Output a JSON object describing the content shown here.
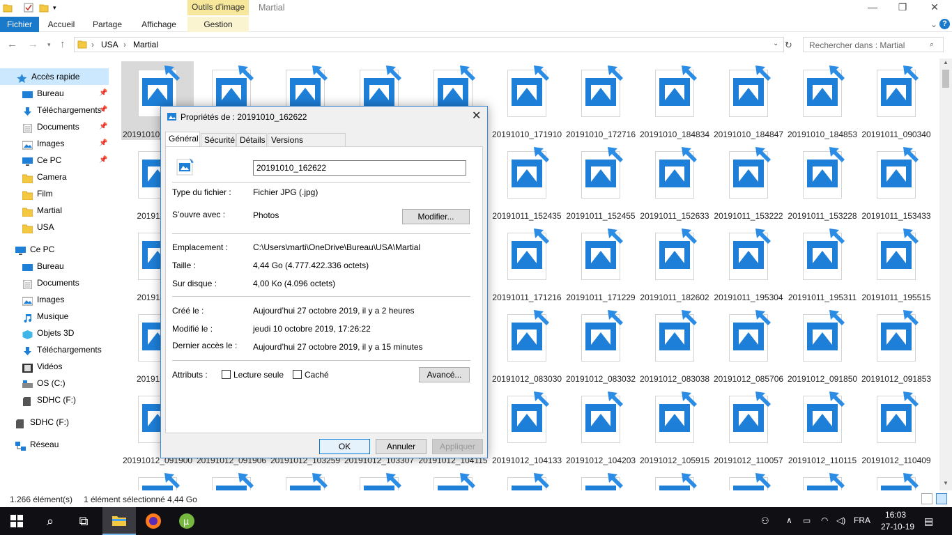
{
  "window": {
    "title": "Martial",
    "context_tab": "Outils d’image",
    "controls": {
      "minimize": "—",
      "restore": "❐",
      "close": "✕"
    }
  },
  "ribbon": {
    "tabs": [
      "Fichier",
      "Accueil",
      "Partage",
      "Affichage",
      "Gestion"
    ],
    "help": "?"
  },
  "address": {
    "crumbs": [
      "USA",
      "Martial"
    ],
    "search_placeholder": "Rechercher dans : Martial"
  },
  "nav": {
    "items": [
      {
        "label": "Accès rapide",
        "icon": "star-icon"
      },
      {
        "label": "Bureau",
        "icon": "desktop-icon",
        "pinned": true
      },
      {
        "label": "Téléchargements",
        "icon": "download-icon",
        "pinned": true
      },
      {
        "label": "Documents",
        "icon": "documents-icon",
        "pinned": true
      },
      {
        "label": "Images",
        "icon": "images-icon",
        "pinned": true
      },
      {
        "label": "Ce PC",
        "icon": "pc-icon",
        "pinned": true
      },
      {
        "label": "Camera",
        "icon": "folder-icon"
      },
      {
        "label": "Film",
        "icon": "folder-icon"
      },
      {
        "label": "Martial",
        "icon": "folder-icon"
      },
      {
        "label": "USA",
        "icon": "folder-icon"
      },
      {
        "label": "Ce PC",
        "icon": "pc-icon"
      },
      {
        "label": "Bureau",
        "icon": "desktop-icon"
      },
      {
        "label": "Documents",
        "icon": "documents-icon"
      },
      {
        "label": "Images",
        "icon": "images-icon"
      },
      {
        "label": "Musique",
        "icon": "music-icon"
      },
      {
        "label": "Objets 3D",
        "icon": "cube-icon"
      },
      {
        "label": "Téléchargements",
        "icon": "download-icon"
      },
      {
        "label": "Vidéos",
        "icon": "video-icon"
      },
      {
        "label": "OS (C:)",
        "icon": "drive-icon"
      },
      {
        "label": "SDHC (F:)",
        "icon": "sd-icon"
      },
      {
        "label": "SDHC (F:)",
        "icon": "sd-icon"
      },
      {
        "label": "Réseau",
        "icon": "network-icon"
      }
    ]
  },
  "files": {
    "rows": [
      [
        "20191010_162622",
        "",
        "",
        "",
        "",
        "20191010_171910",
        "20191010_172716",
        "20191010_184834",
        "20191010_184847",
        "20191010_184853",
        "20191011_090340"
      ],
      [
        "20191011_",
        "",
        "",
        "",
        "",
        "20191011_152435",
        "20191011_152455",
        "20191011_152633",
        "20191011_153222",
        "20191011_153228",
        "20191011_153433"
      ],
      [
        "20191011_",
        "",
        "",
        "",
        "",
        "20191011_171216",
        "20191011_171229",
        "20191011_182602",
        "20191011_195304",
        "20191011_195311",
        "20191011_195515"
      ],
      [
        "20191012_",
        "",
        "",
        "",
        "",
        "20191012_083030",
        "20191012_083032",
        "20191012_083038",
        "20191012_085706",
        "20191012_091850",
        "20191012_091853"
      ],
      [
        "20191012_091900",
        "20191012_091906",
        "20191012_103259",
        "20191012_103307",
        "20191012_104115",
        "20191012_104133",
        "20191012_104203",
        "20191012_105915",
        "20191012_110057",
        "20191012_110115",
        "20191012_110409"
      ]
    ]
  },
  "status": {
    "count": "1.266 élément(s)",
    "selection": "1 élément sélectionné  4,44 Go"
  },
  "dialog": {
    "title": "Propriétés de : 20191010_162622",
    "tabs": [
      "Général",
      "Sécurité",
      "Détails",
      "Versions précédentes"
    ],
    "filename": "20191010_162622",
    "type_label": "Type du fichier :",
    "type_value": "Fichier JPG (.jpg)",
    "opens_label": "S’ouvre avec :",
    "opens_value": "Photos",
    "modify_button": "Modifier...",
    "location_label": "Emplacement :",
    "location_value": "C:\\Users\\marti\\OneDrive\\Bureau\\USA\\Martial",
    "size_label": "Taille :",
    "size_value": "4,44 Go (4.777.422.336 octets)",
    "disk_label": "Sur disque :",
    "disk_value": "4,00 Ko (4.096 octets)",
    "created_label": "Créé le :",
    "created_value": "Aujourd’hui 27 octobre 2019, il y a 2 heures",
    "modified_label": "Modifié le :",
    "modified_value": "jeudi 10 octobre 2019, 17:26:22",
    "accessed_label": "Dernier accès le :",
    "accessed_value": "Aujourd’hui 27 octobre 2019, il y a 15 minutes",
    "attrs_label": "Attributs :",
    "readonly_label": "Lecture seule",
    "hidden_label": "Caché",
    "advanced_button": "Avancé...",
    "ok": "OK",
    "cancel": "Annuler",
    "apply": "Appliquer"
  },
  "taskbar": {
    "lang": "FRA",
    "time": "16:03",
    "date": "27-10-19"
  },
  "colors": {
    "accent": "#1979ca",
    "icon_blue": "#1e7fd8",
    "context": "#f6e79b"
  }
}
